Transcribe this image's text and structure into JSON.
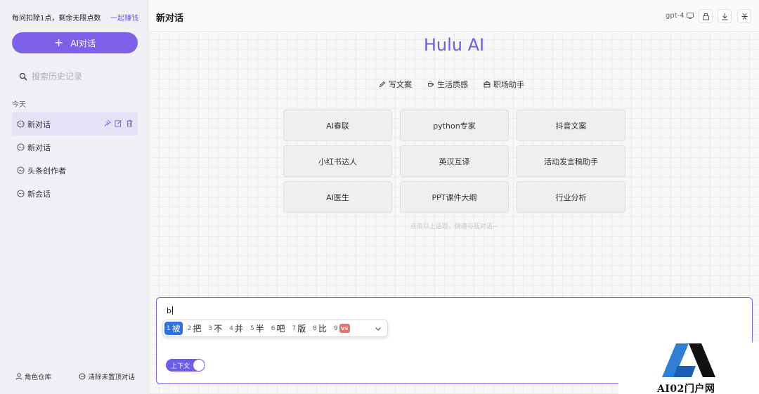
{
  "sidebar": {
    "promo_text": "每问扣除1点，剩余无限点数",
    "promo_link": "一起赚钱",
    "new_chat_label": "AI对话",
    "search_placeholder": "搜索历史记录",
    "group_label": "今天",
    "conversations": [
      {
        "title": "新对话",
        "active": true
      },
      {
        "title": "新对话",
        "active": false
      },
      {
        "title": "头条创作者",
        "active": false
      },
      {
        "title": "新会话",
        "active": false
      }
    ],
    "footer": {
      "roles_label": "角色仓库",
      "clear_label": "清除未置顶对话"
    }
  },
  "header": {
    "title": "新对话",
    "model": "gpt-4"
  },
  "main": {
    "brand": "Hulu AI",
    "categories": [
      "写文案",
      "生活质感",
      "职场助手"
    ],
    "prompts": [
      "AI春联",
      "python专家",
      "抖音文案",
      "小红书达人",
      "英汉互译",
      "活动发言稿助手",
      "AI医生",
      "PPT课件大纲",
      "行业分析"
    ],
    "hint": "点击以上话题，快速与我对话~"
  },
  "composer": {
    "input_value": "b",
    "context_toggle_label": "上下文",
    "context_enabled": true
  },
  "ime": {
    "candidates": [
      {
        "num": "1",
        "text": "被"
      },
      {
        "num": "2",
        "text": "把"
      },
      {
        "num": "3",
        "text": "不"
      },
      {
        "num": "4",
        "text": "并"
      },
      {
        "num": "5",
        "text": "半"
      },
      {
        "num": "6",
        "text": "吧"
      },
      {
        "num": "7",
        "text": "版"
      },
      {
        "num": "8",
        "text": "比"
      }
    ],
    "vs_num": "9",
    "vs_badge": "VS"
  },
  "watermark": {
    "text": "AI02门户网"
  },
  "colors": {
    "accent": "#7b61e8",
    "brand": "#6c5ce7",
    "ime_selected": "#2f6fe4"
  }
}
